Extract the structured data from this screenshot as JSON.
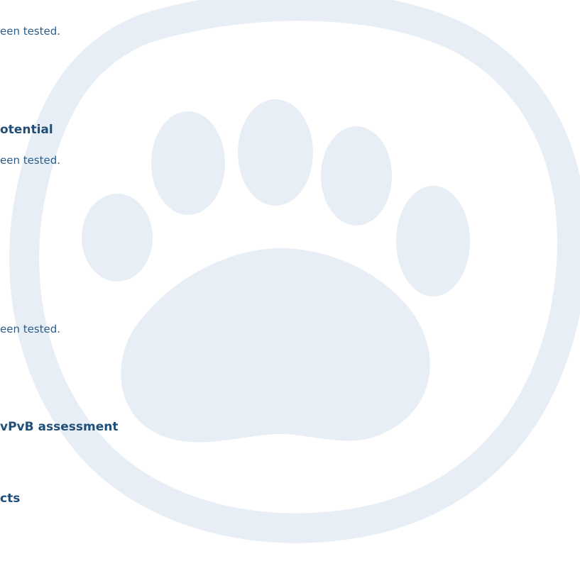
{
  "document": {
    "lines": [
      "een tested.",
      "otential",
      "een tested.",
      "een tested.",
      "vPvB assessment",
      "cts"
    ]
  },
  "colors": {
    "text": "#2c5d8a",
    "heading": "#1f4e79",
    "watermark": "#e8eef5"
  },
  "watermark": {
    "icon": "paw-print-icon"
  }
}
